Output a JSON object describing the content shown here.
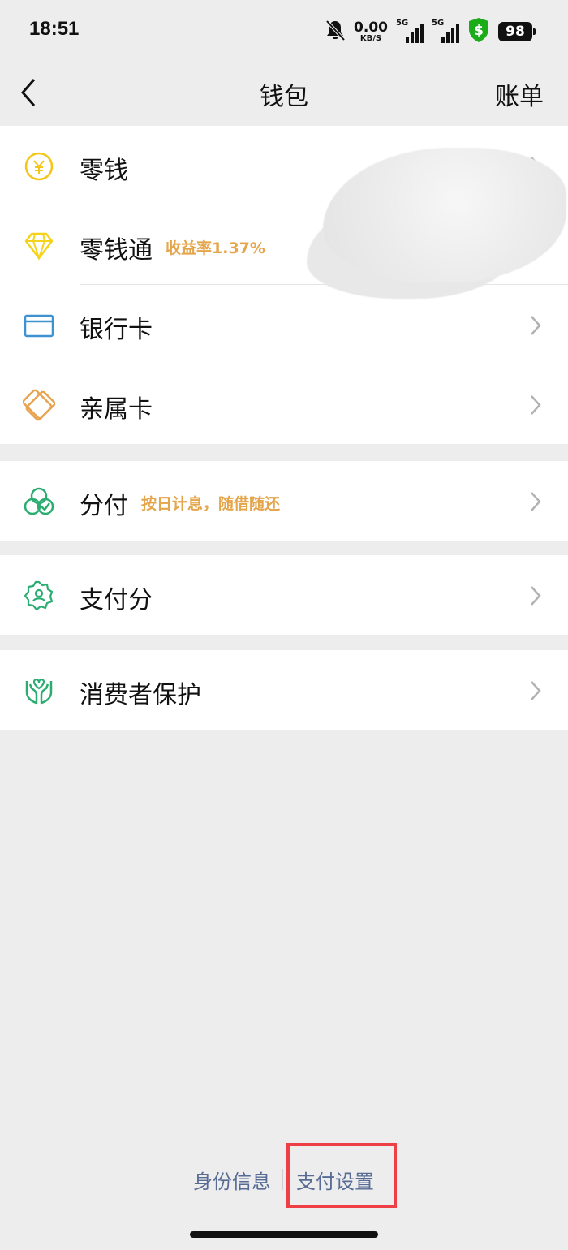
{
  "status_bar": {
    "time": "18:51",
    "net_speed_value": "0.00",
    "net_speed_unit": "KB/S",
    "signal1_tag": "5G",
    "signal2_tag": "5G",
    "battery": "98",
    "icons": [
      "mute-bell-icon",
      "signal-icon",
      "signal-icon",
      "security-shield-icon",
      "battery-icon"
    ]
  },
  "nav": {
    "back_icon": "chevron-left-icon",
    "title": "钱包",
    "bill_label": "账单"
  },
  "groups": [
    {
      "items": [
        {
          "label": "零钱",
          "icon": "yuan-coin-icon",
          "color": "#f5c518"
        },
        {
          "label": "零钱通",
          "tag": "收益率1.37%",
          "icon": "diamond-icon",
          "color": "#f5d31b"
        },
        {
          "label": "银行卡",
          "icon": "bank-card-icon",
          "color": "#3d93d2"
        },
        {
          "label": "亲属卡",
          "icon": "family-card-icon",
          "color": "#e8a351"
        }
      ]
    },
    {
      "items": [
        {
          "label": "分付",
          "tag": "按日计息，随借随还",
          "icon": "fenfu-icon",
          "color": "#2bad72"
        }
      ]
    },
    {
      "items": [
        {
          "label": "支付分",
          "icon": "pay-score-badge-icon",
          "color": "#2bad72"
        }
      ]
    },
    {
      "items": [
        {
          "label": "消费者保护",
          "icon": "hands-protect-icon",
          "color": "#2bad72"
        }
      ]
    }
  ],
  "footer": {
    "identity_label": "身份信息",
    "pay_settings_label": "支付设置"
  },
  "colors": {
    "background": "#ededed",
    "tag_orange": "#e4a54b",
    "link_blue": "#576b95",
    "highlight_red": "#ef3f46"
  }
}
